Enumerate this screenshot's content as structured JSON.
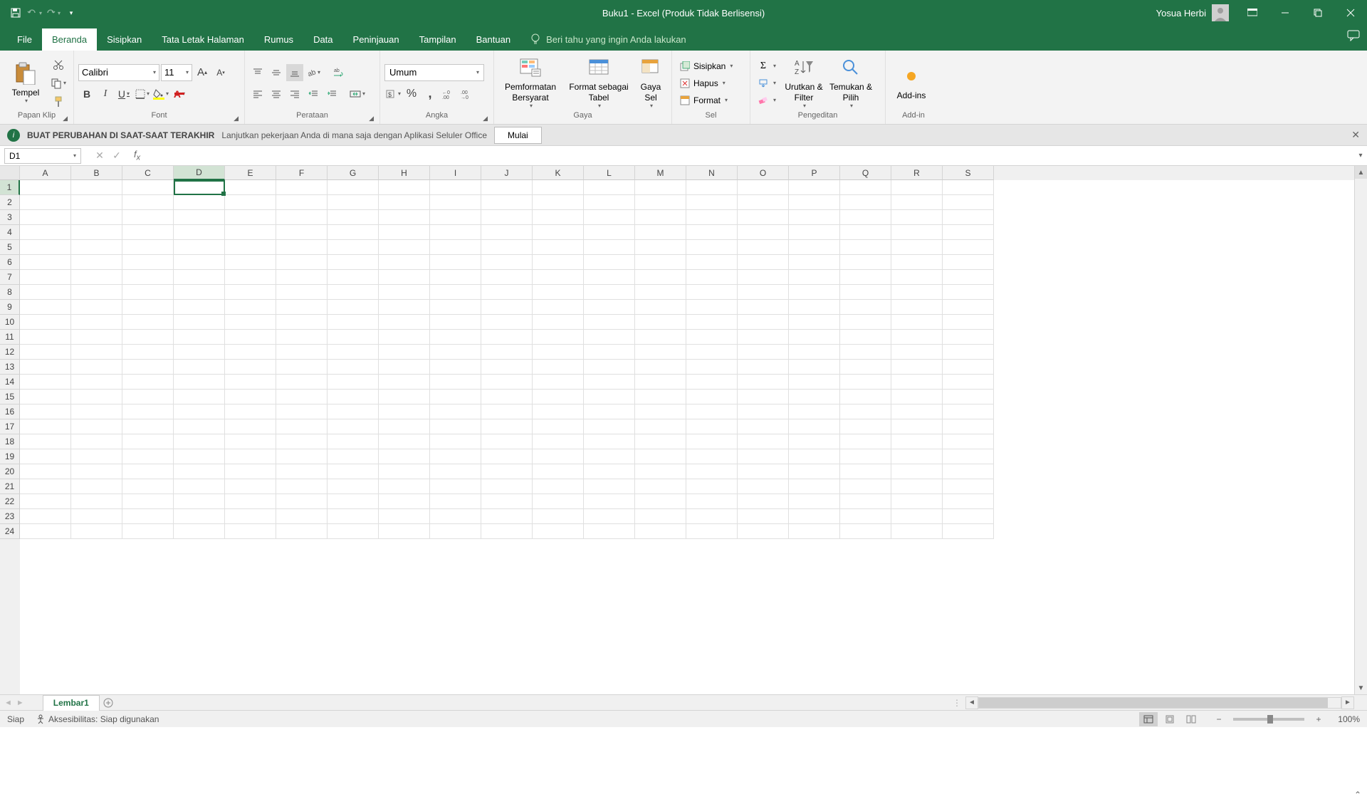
{
  "title": "Buku1  -  Excel (Produk Tidak Berlisensi)",
  "user_name": "Yosua Herbi",
  "tabs": {
    "file": "File",
    "home": "Beranda",
    "insert": "Sisipkan",
    "layout": "Tata Letak Halaman",
    "formulas": "Rumus",
    "data": "Data",
    "review": "Peninjauan",
    "view": "Tampilan",
    "help": "Bantuan",
    "tellme": "Beri tahu yang ingin Anda lakukan"
  },
  "ribbon": {
    "clipboard": {
      "paste": "Tempel",
      "label": "Papan Klip"
    },
    "font": {
      "name": "Calibri",
      "size": "11",
      "label": "Font"
    },
    "alignment": {
      "label": "Perataan"
    },
    "number": {
      "format": "Umum",
      "label": "Angka"
    },
    "styles": {
      "condfmt": "Pemformatan Bersyarat",
      "tablefmt": "Format sebagai Tabel",
      "cellstyles": "Gaya Sel",
      "label": "Gaya"
    },
    "cells": {
      "insert": "Sisipkan",
      "delete": "Hapus",
      "format": "Format",
      "label": "Sel"
    },
    "editing": {
      "sort": "Urutkan & Filter",
      "find": "Temukan & Pilih",
      "label": "Pengeditan"
    },
    "addins": {
      "btn": "Add-ins",
      "label": "Add-in"
    }
  },
  "infobar": {
    "headline": "BUAT PERUBAHAN DI SAAT-SAAT TERAKHIR",
    "text": "Lanjutkan pekerjaan Anda di mana saja dengan Aplikasi Seluler Office",
    "button": "Mulai"
  },
  "namebox": "D1",
  "columns": [
    "A",
    "B",
    "C",
    "D",
    "E",
    "F",
    "G",
    "H",
    "I",
    "J",
    "K",
    "L",
    "M",
    "N",
    "O",
    "P",
    "Q",
    "R",
    "S"
  ],
  "selected_col_index": 3,
  "rows_visible": 24,
  "selected_row": 1,
  "sheet_tab": "Lembar1",
  "status": {
    "ready": "Siap",
    "accessibility": "Aksesibilitas: Siap digunakan",
    "zoom": "100%"
  }
}
